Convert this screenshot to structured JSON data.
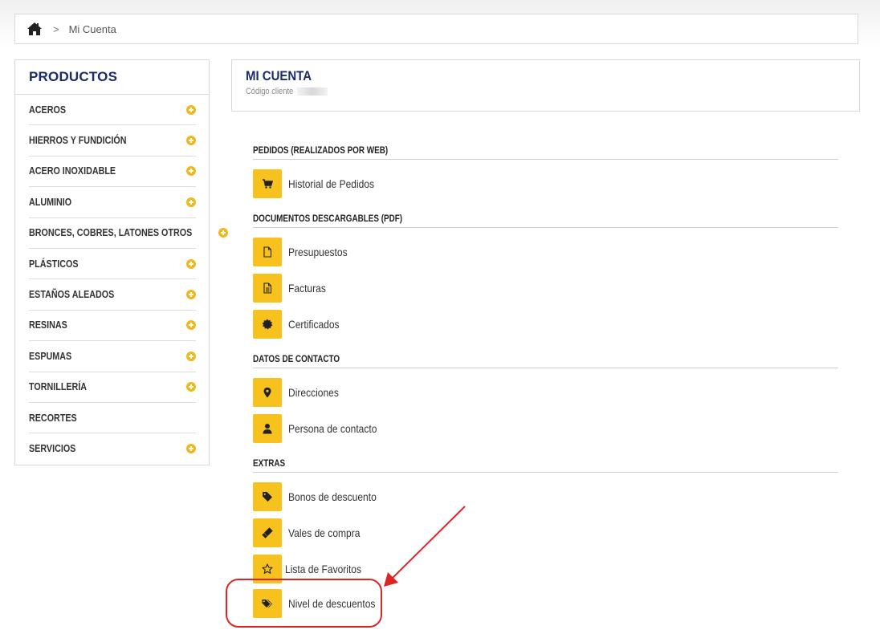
{
  "breadcrumb": {
    "home_icon": "home-icon",
    "separator": ">",
    "current": "Mi Cuenta"
  },
  "sidebar": {
    "title": "PRODUCTOS",
    "items": [
      {
        "label": "ACEROS",
        "expandable": true
      },
      {
        "label": "HIERROS Y FUNDICIÓN",
        "expandable": true
      },
      {
        "label": "ACERO INOXIDABLE",
        "expandable": true
      },
      {
        "label": "ALUMINIO",
        "expandable": true
      },
      {
        "label": "BRONCES, COBRES, LATONES OTROS",
        "expandable": true
      },
      {
        "label": "PLÁSTICOS",
        "expandable": true
      },
      {
        "label": "ESTAÑOS ALEADOS",
        "expandable": true
      },
      {
        "label": "RESINAS",
        "expandable": true
      },
      {
        "label": "ESPUMAS",
        "expandable": true
      },
      {
        "label": "TORNILLERÍA",
        "expandable": true
      },
      {
        "label": "RECORTES",
        "expandable": false
      },
      {
        "label": "SERVICIOS",
        "expandable": true
      }
    ]
  },
  "account": {
    "title": "MI CUENTA",
    "client_code_label": "Código cliente"
  },
  "sections": {
    "orders": {
      "heading": "PEDIDOS (REALIZADOS POR WEB)",
      "links": [
        {
          "label": "Historial de Pedidos",
          "icon": "cart-icon"
        }
      ]
    },
    "documents": {
      "heading": "DOCUMENTOS DESCARGABLES (PDF)",
      "links": [
        {
          "label": "Presupuestos",
          "icon": "file-icon"
        },
        {
          "label": "Facturas",
          "icon": "file-text-icon"
        },
        {
          "label": "Certificados",
          "icon": "certificate-icon"
        }
      ]
    },
    "contact": {
      "heading": "DATOS DE CONTACTO",
      "links": [
        {
          "label": "Direcciones",
          "icon": "map-marker-icon"
        },
        {
          "label": "Persona de contacto",
          "icon": "user-icon"
        }
      ]
    },
    "extras": {
      "heading": "EXTRAS",
      "links": [
        {
          "label": "Bonos de descuento",
          "icon": "tag-icon"
        },
        {
          "label": "Vales de compra",
          "icon": "ticket-icon"
        },
        {
          "label": "Lista de Favoritos",
          "icon": "star-outline-icon"
        },
        {
          "label": "Nivel de descuentos",
          "icon": "tags-icon"
        }
      ]
    }
  },
  "colors": {
    "accent_yellow": "#f7c21e",
    "plus_icon": "#f2b81b",
    "title_navy": "#1a2a6c",
    "annotation_red": "#e02424"
  }
}
